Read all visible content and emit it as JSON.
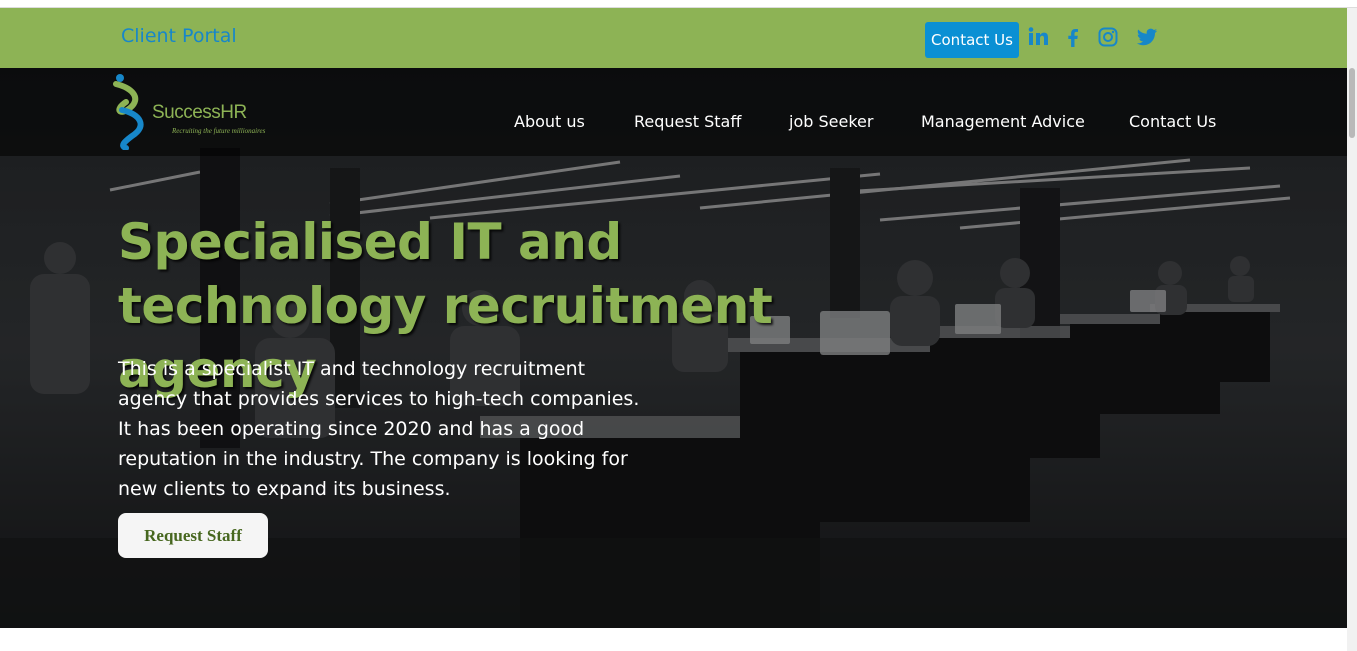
{
  "topbar": {
    "client_portal": "Client Portal",
    "contact_button": "Contact Us",
    "social_icons": [
      "linkedin-icon",
      "facebook-icon",
      "instagram-icon",
      "twitter-icon"
    ],
    "background_color": "#8db355",
    "link_color": "#1787c9",
    "button_color": "#0a90d4"
  },
  "logo": {
    "name": "SuccessHR",
    "tagline": "Recruiting the future millionaires"
  },
  "nav": {
    "items": [
      "About us",
      "Request Staff",
      "job Seeker",
      "Management Advice",
      "Contact Us"
    ]
  },
  "hero": {
    "title": "Specialised IT and technology recruitment agency",
    "description": "This is a specialist IT and technology recruitment agency that provides services to high-tech companies. It has been operating since 2020 and has a good reputation in the industry. The company is looking for new clients to expand its business.",
    "cta_label": "Request Staff",
    "accent_color": "#8db355"
  }
}
